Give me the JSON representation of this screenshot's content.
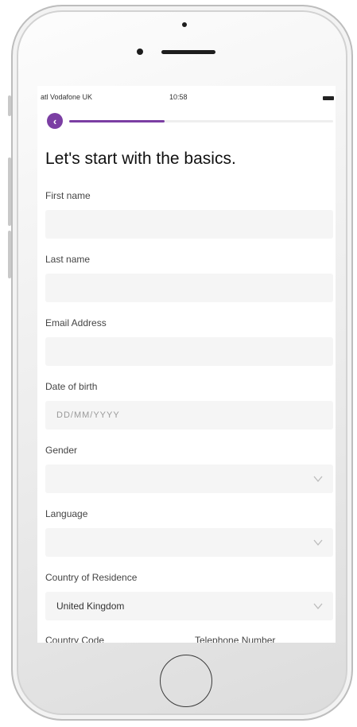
{
  "status_bar": {
    "carrier": "atl Vodafone UK",
    "time": "10:58"
  },
  "header": {
    "progress": 0.36
  },
  "page": {
    "title": "Let's start with the basics."
  },
  "fields": [
    {
      "label": "First name",
      "value": "",
      "placeholder": ""
    },
    {
      "label": "Last name",
      "value": "",
      "placeholder": ""
    },
    {
      "label": "Email Address",
      "value": "",
      "placeholder": ""
    },
    {
      "label": "Date of birth",
      "value": "",
      "placeholder": "DD/MM/YYYY"
    },
    {
      "label": "Gender",
      "value": "",
      "placeholder": ""
    },
    {
      "label": "Language",
      "value": "",
      "placeholder": ""
    },
    {
      "label": "Country of Residence",
      "value": "United Kingdom",
      "placeholder": ""
    }
  ],
  "bottom_fields": {
    "country_code_label": "Country Code",
    "telephone_label": "Telephone Number"
  },
  "colors": {
    "accent": "#7b3ea3",
    "field_bg": "#f5f5f5"
  }
}
